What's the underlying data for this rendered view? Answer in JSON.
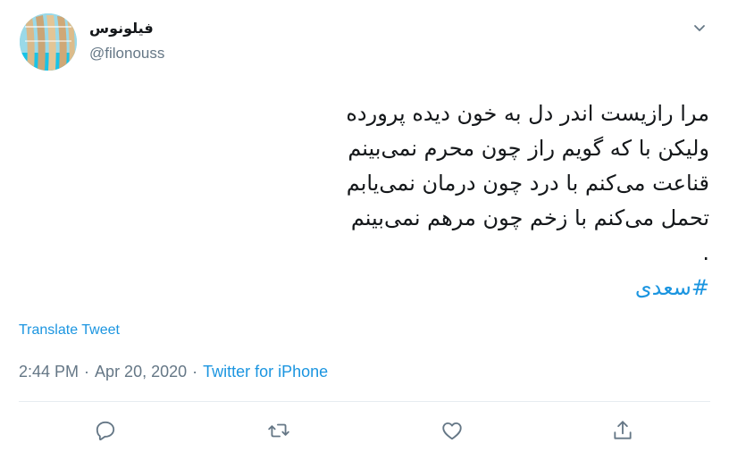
{
  "user": {
    "display_name": "فیلونوس",
    "handle": "@filonouss"
  },
  "tweet": {
    "lines": [
      "مرا رازیست اندر دل به خون دیده پرورده",
      "ولیکن با که گویم راز چون محرم نمی‌بینم",
      "قناعت می‌کنم با درد چون درمان نمی‌یابم",
      "تحمل می‌کنم با زخم چون مرهم نمی‌بینم",
      "."
    ],
    "hashtag": "#سعدی"
  },
  "translate_label": "Translate Tweet",
  "meta": {
    "time": "2:44 PM",
    "separator": "·",
    "date": "Apr 20, 2020",
    "source": "Twitter for iPhone"
  },
  "icons": {
    "menu": "chevron-down-icon",
    "reply": "reply-icon",
    "retweet": "retweet-icon",
    "like": "heart-icon",
    "share": "share-icon"
  },
  "colors": {
    "link": "#1b95e0",
    "muted": "#657786",
    "text": "#14171a",
    "divider": "#e6ecf0"
  }
}
